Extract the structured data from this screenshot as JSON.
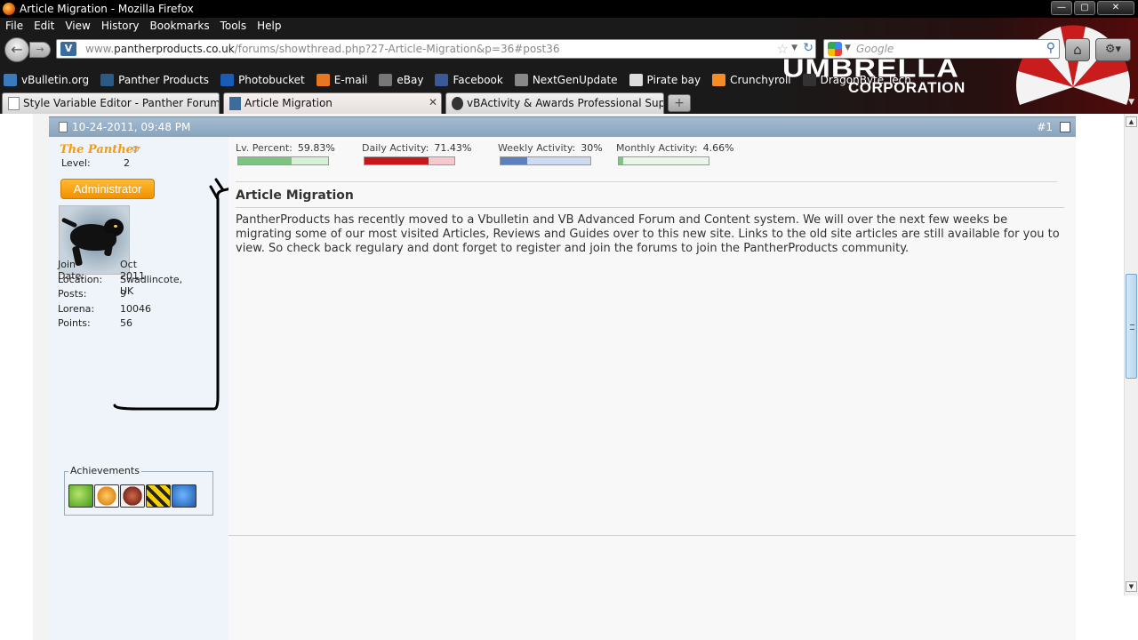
{
  "window": {
    "title": "Article Migration - Mozilla Firefox",
    "buttons": {
      "minimize": "—",
      "maximize": "▢",
      "close": "✕"
    }
  },
  "menu": [
    "File",
    "Edit",
    "View",
    "History",
    "Bookmarks",
    "Tools",
    "Help"
  ],
  "nav": {
    "url_domain": "www.",
    "url_host": "pantherproducts.co.uk",
    "url_path": "/forums/showthread.php?27-Article-Migration&p=36#post36",
    "search_placeholder": "Google"
  },
  "bookmarks": [
    {
      "label": "vBulletin.org",
      "icon": "vb-icon",
      "color": "#3a7abd"
    },
    {
      "label": "Panther Products",
      "icon": "panther-icon",
      "color": "#2c5a86"
    },
    {
      "label": "Photobucket",
      "icon": "photobucket-icon",
      "color": "#1b5bb5"
    },
    {
      "label": "E-mail",
      "icon": "windows-icon",
      "color": "#e87722"
    },
    {
      "label": "eBay",
      "icon": "ebay-icon",
      "color": "#777"
    },
    {
      "label": "Facebook",
      "icon": "facebook-icon",
      "color": "#3b5998"
    },
    {
      "label": "NextGenUpdate",
      "icon": "ngu-icon",
      "color": "#888"
    },
    {
      "label": "Pirate bay",
      "icon": "pirate-icon",
      "color": "#ddd"
    },
    {
      "label": "Crunchyroll",
      "icon": "crunchyroll-icon",
      "color": "#f78b24"
    },
    {
      "label": "DragonByte Tech",
      "icon": "dragonbyte-icon",
      "color": "#333"
    }
  ],
  "brand": {
    "line1": "UMBRELLA",
    "line2": "CORPORATION"
  },
  "tabs": [
    {
      "label": "Style Variable Editor - Panther Forum...",
      "active": false
    },
    {
      "label": "Article Migration",
      "active": true,
      "close": "✕"
    },
    {
      "label": "vBActivity & Awards Professional Sup...",
      "active": false
    }
  ],
  "newtab": "+",
  "post": {
    "date": "10-24-2011, 09:48 PM",
    "number": "#1",
    "user": {
      "name": "The Panther",
      "level_label": "Level:",
      "level": "2",
      "rank": "Administrator",
      "stats": [
        {
          "key": "Join Date:",
          "value": "Oct 2011"
        },
        {
          "key": "Location:",
          "value": "Swadlincote, UK"
        },
        {
          "key": "Posts:",
          "value": "9"
        },
        {
          "key": "Lorena:",
          "value": "10046"
        },
        {
          "key": "Points:",
          "value": "56"
        }
      ],
      "achievements_label": "Achievements"
    },
    "activity": [
      {
        "label": "Lv. Percent:",
        "value": "59.83%",
        "fraction": 0.5983,
        "fill": "#7cc47f",
        "bg": "bar-bg-green"
      },
      {
        "label": "Daily Activity:",
        "value": "71.43%",
        "fraction": 0.7143,
        "fill": "#c8161d",
        "bg": "bar-bg-red"
      },
      {
        "label": "Weekly Activity:",
        "value": "30%",
        "fraction": 0.3,
        "fill": "#5b7fbf",
        "bg": "bar-bg-blue"
      },
      {
        "label": "Monthly Activity:",
        "value": "4.66%",
        "fraction": 0.0466,
        "fill": "#7cc47f",
        "bg": "bar-bg-lgreen"
      }
    ],
    "title": "Article Migration",
    "body": "PantherProducts has recently moved to a Vbulletin and VB Advanced Forum and Content system. We will over the next few weeks be migrating some of our most visited Articles, Reviews and Guides over to this new site. Links to the old site articles are still available for you to view. So check back regulary and dont forget to register and join the forums to join the PantherProducts community."
  },
  "colors": {
    "post_header": "#93adc5",
    "username": "#f39c12",
    "admin_badge": "#f5a11a"
  }
}
